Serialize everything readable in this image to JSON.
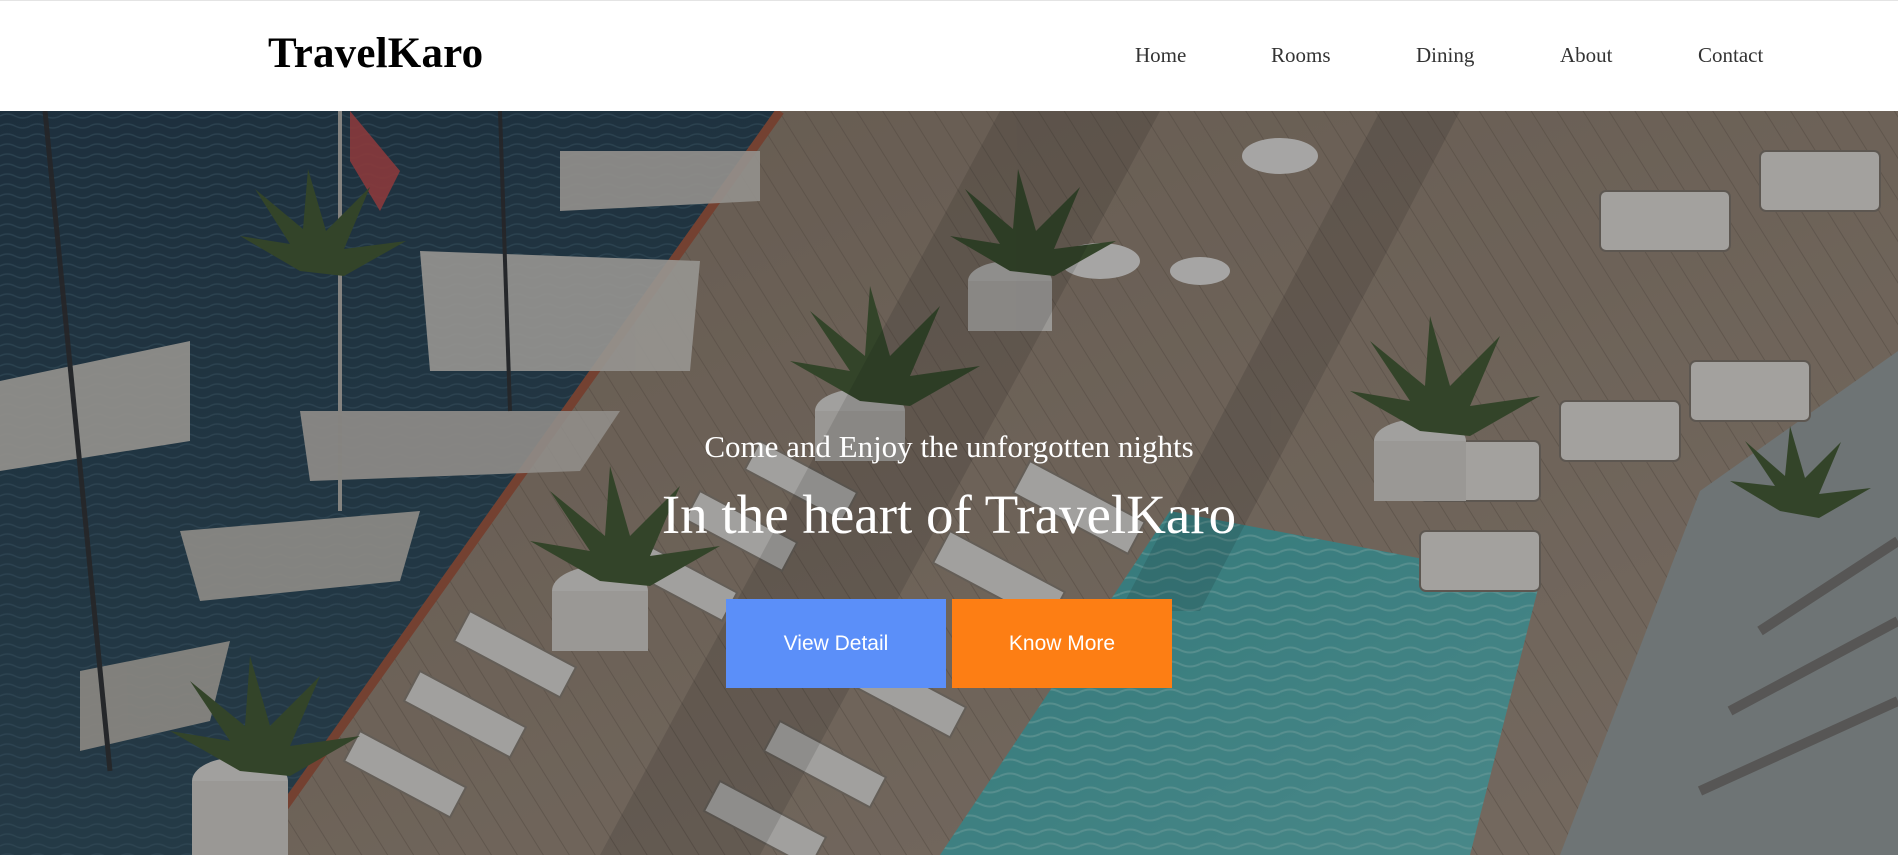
{
  "header": {
    "brand": "TravelKaro",
    "nav": [
      "Home",
      "Rooms",
      "Dining",
      "About",
      "Contact"
    ]
  },
  "hero": {
    "tagline": "Come and Enjoy the unforgotten nights",
    "headline": "In the heart of TravelKaro",
    "buttons": {
      "primary": "View Detail",
      "secondary": "Know More"
    },
    "background_image": "aerial view of a hotel pool deck with lounge chairs, palm trees and boats in the marina"
  },
  "colors": {
    "primary_button": "#5b8ff9",
    "secondary_button": "#fd7e14"
  }
}
